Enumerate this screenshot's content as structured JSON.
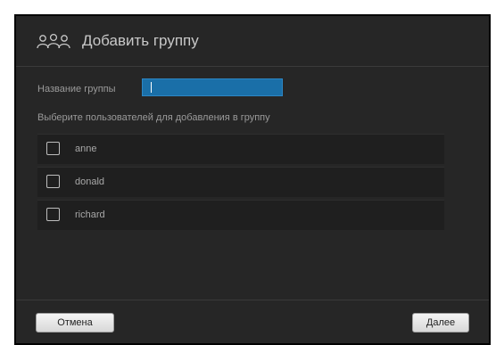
{
  "dialog": {
    "title": "Добавить группу",
    "icon": "group-icon"
  },
  "form": {
    "name_label": "Название группы",
    "name_value": "",
    "select_label": "Выберите пользователей для добавления в группу"
  },
  "users": [
    {
      "name": "anne",
      "checked": false
    },
    {
      "name": "donald",
      "checked": false
    },
    {
      "name": "richard",
      "checked": false
    }
  ],
  "footer": {
    "cancel_label": "Отмена",
    "next_label": "Далее"
  },
  "colors": {
    "dialog_bg": "#262626",
    "input_accent": "#1a6fa8",
    "text_muted": "#9a9a9a"
  }
}
